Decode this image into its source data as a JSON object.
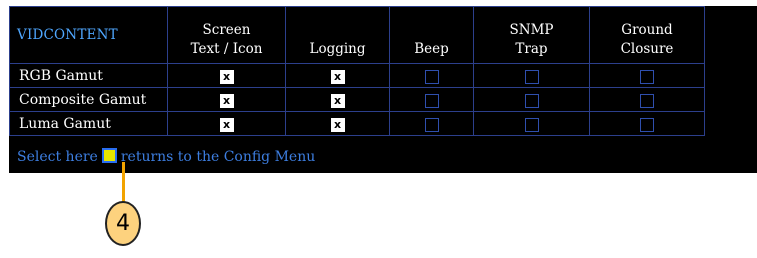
{
  "table": {
    "title": "VIDCONTENT",
    "headers": [
      {
        "line1": "Screen",
        "line2": "Text / Icon"
      },
      {
        "line1": "",
        "line2": "Logging"
      },
      {
        "line1": "",
        "line2": "Beep"
      },
      {
        "line1": "SNMP",
        "line2": "Trap"
      },
      {
        "line1": "Ground",
        "line2": "Closure"
      }
    ],
    "rows": [
      {
        "label": "RGB Gamut",
        "checks": [
          true,
          true,
          false,
          false,
          false
        ]
      },
      {
        "label": "Composite Gamut",
        "checks": [
          true,
          true,
          false,
          false,
          false
        ]
      },
      {
        "label": "Luma Gamut",
        "checks": [
          true,
          true,
          false,
          false,
          false
        ]
      }
    ],
    "check_mark": "x"
  },
  "footer": {
    "prefix": "Select here",
    "suffix": "returns to the Config Menu"
  },
  "callout": {
    "number": "4"
  },
  "colors": {
    "title": "#4fa7ff",
    "footer_text": "#3d7ee0",
    "select_box": "#e6e600",
    "callout_fill": "#fdd27e",
    "leader": "#f2a300"
  }
}
